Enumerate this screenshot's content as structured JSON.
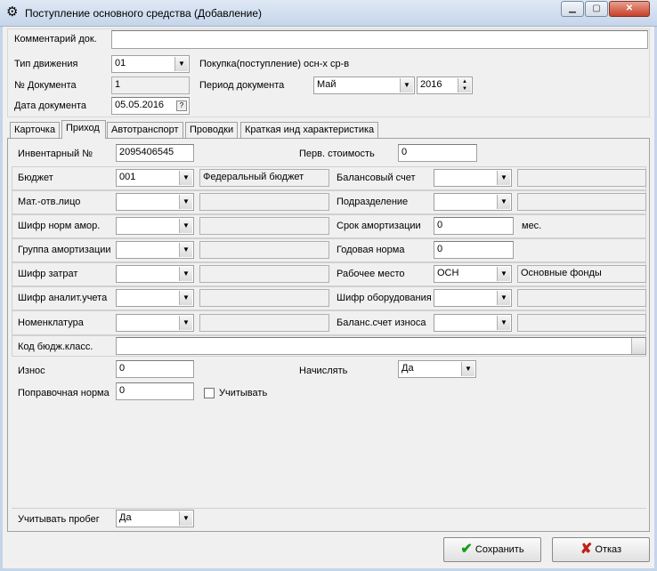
{
  "window": {
    "title": "Поступление основного средства (Добавление)",
    "min": "▁",
    "max": "▢",
    "close": "✕"
  },
  "header": {
    "comment_label": "Комментарий док.",
    "comment_value": "",
    "move_type_label": "Тип движения",
    "move_type_value": "01",
    "move_type_desc": "Покупка(поступление) осн-х ср-в",
    "doc_no_label": "№ Документа",
    "doc_no_value": "1",
    "period_label": "Период документа",
    "period_month": "Май",
    "period_year": "2016",
    "doc_date_label": "Дата документа",
    "doc_date_value": "05.05.2016"
  },
  "tabs": [
    "Карточка",
    "Приход",
    "Автотранспорт",
    "Проводки",
    "Краткая инд характеристика"
  ],
  "form": {
    "inv_label": "Инвентарный №",
    "inv_value": "2095406545",
    "cost_label": "Перв. стоимость",
    "cost_value": "0",
    "budget_label": "Бюджет",
    "budget_value": "001",
    "budget_desc": "Федеральный бюджет",
    "balance_label": "Балансовый счет",
    "balance_value": "",
    "mol_label": "Мат.-отв.лицо",
    "mol_value": "",
    "division_label": "Подразделение",
    "division_value": "",
    "amort_code_label": "Шифр норм амор.",
    "amort_code_value": "",
    "amort_term_label": "Срок амортизации",
    "amort_term_value": "0",
    "amort_term_unit": "мес.",
    "amort_group_label": "Группа амортизации",
    "amort_group_value": "",
    "annual_norm_label": "Годовая норма",
    "annual_norm_value": "0",
    "cost_code_label": "Шифр затрат",
    "cost_code_value": "",
    "workplace_label": "Рабочее место",
    "workplace_value": "ОСН",
    "workplace_desc": "Основные фонды",
    "analyt_label": "Шифр аналит.учета",
    "analyt_value": "",
    "equip_label": "Шифр оборудования",
    "equip_value": "",
    "nomencl_label": "Номенклатура",
    "nomencl_value": "",
    "wear_acc_label": "Баланс.счет износа",
    "wear_acc_value": "",
    "kbk_label": "Код бюдж.класс.",
    "kbk_value": "",
    "wear_label": "Износ",
    "wear_value": "0",
    "accrue_label": "Начислять",
    "accrue_value": "Да",
    "corr_label": "Поправочная норма",
    "corr_value": "0",
    "consider_label": "Учитывать",
    "mileage_label": "Учитывать пробег",
    "mileage_value": "Да"
  },
  "buttons": {
    "save": "Сохранить",
    "cancel": "Отказ"
  }
}
